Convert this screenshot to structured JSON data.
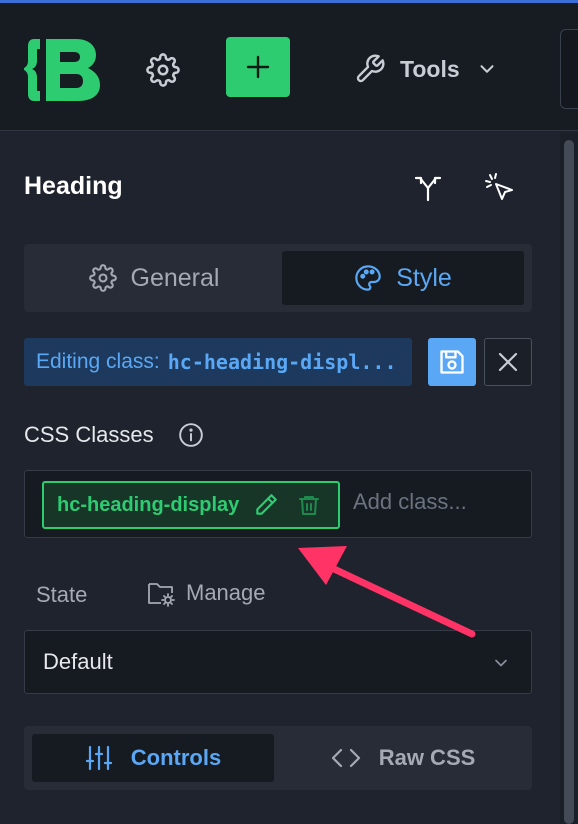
{
  "toolbar": {
    "logo_icon": "builder-logo-icon",
    "settings_icon": "gear-icon",
    "add_icon": "plus-icon",
    "tools_label": "Tools",
    "tools_icon": "wrench-icon",
    "tools_chevron": "chevron-down-icon"
  },
  "panel": {
    "title": "Heading",
    "title_icons": [
      "fork-icon",
      "cursor-select-icon"
    ],
    "tabs": [
      {
        "label": "General",
        "icon": "gear-icon",
        "active": false
      },
      {
        "label": "Style",
        "icon": "palette-icon",
        "active": true
      }
    ],
    "editing": {
      "prefix": "Editing class:",
      "class_name": "hc-heading-displ...",
      "save_icon": "save-icon",
      "close_icon": "close-icon"
    },
    "css_classes": {
      "label": "CSS Classes",
      "info_icon": "info-icon",
      "chips": [
        {
          "label": "hc-heading-display"
        }
      ],
      "add_placeholder": "Add class..."
    },
    "state": {
      "label": "State",
      "manage_label": "Manage",
      "manage_icon": "folder-gear-icon",
      "selected": "Default"
    },
    "bottom_tabs": [
      {
        "label": "Controls",
        "icon": "sliders-icon",
        "active": true
      },
      {
        "label": "Raw CSS",
        "icon": "code-icon",
        "active": false
      }
    ]
  },
  "colors": {
    "accent_green": "#2ecc71",
    "accent_blue": "#5aa8f5",
    "annotation_arrow": "#ff3366"
  }
}
